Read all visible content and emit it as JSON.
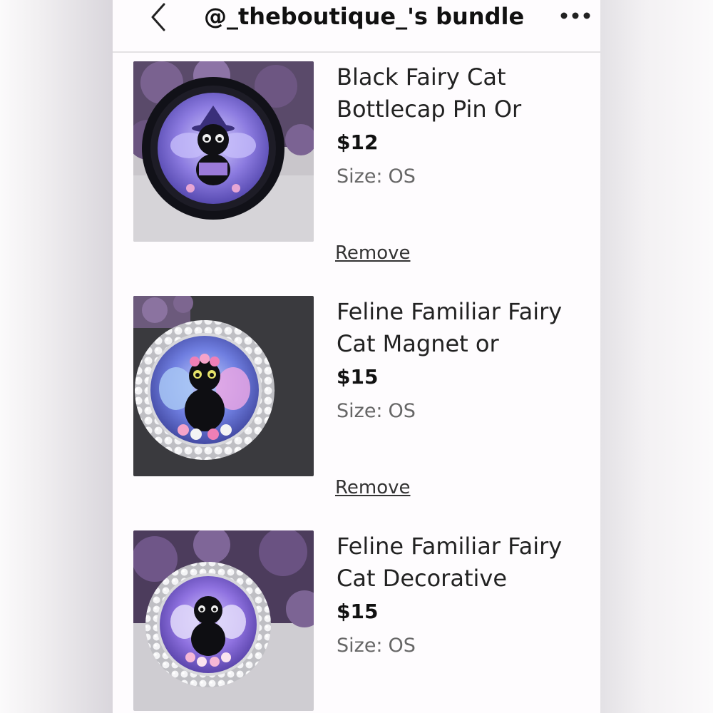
{
  "header": {
    "title": "@_theboutique_'s bundle",
    "back_icon": "chevron-left-icon",
    "menu_icon": "more-horizontal-icon"
  },
  "items": [
    {
      "name_line1": "Black Fairy Cat",
      "name_line2": "Bottlecap Pin Or",
      "price": "$12",
      "size_label": "Size:",
      "size_value": "OS",
      "remove_label": "Remove"
    },
    {
      "name_line1": "Feline Familiar Fairy",
      "name_line2": "Cat Magnet or",
      "price": "$15",
      "size_label": "Size:",
      "size_value": "OS",
      "remove_label": "Remove"
    },
    {
      "name_line1": "Feline Familiar Fairy",
      "name_line2": "Cat Decorative",
      "price": "$15",
      "size_label": "Size:",
      "size_value": "OS"
    }
  ],
  "colors": {
    "accent_purple": "#8c7be0",
    "text_primary": "#111111",
    "text_secondary": "#666666"
  }
}
